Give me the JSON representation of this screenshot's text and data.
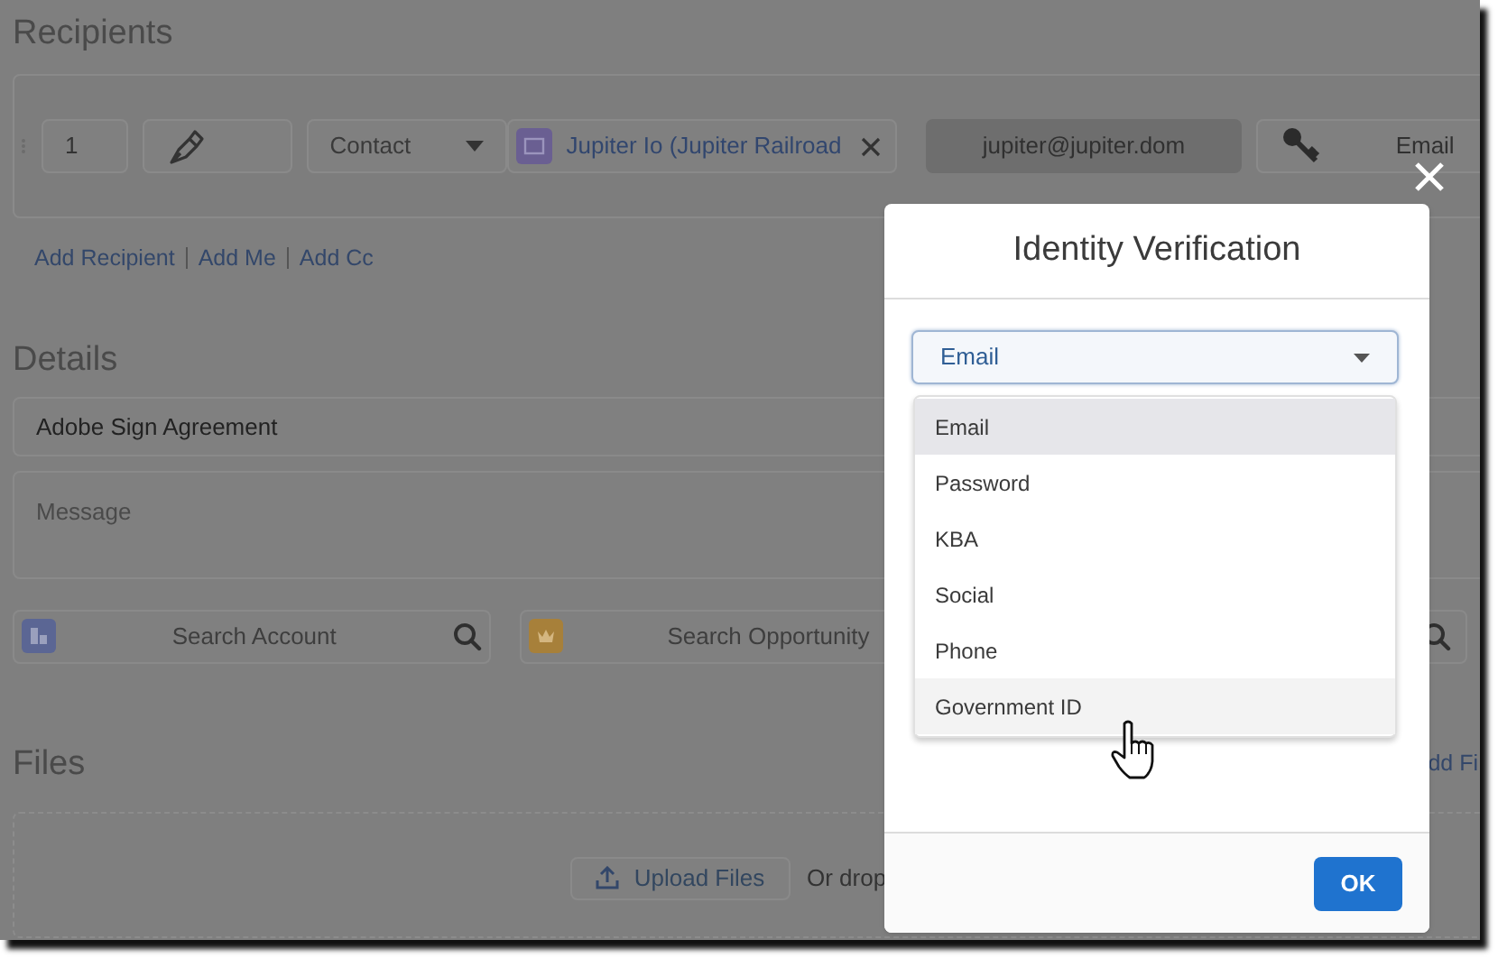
{
  "recipients": {
    "title": "Recipients",
    "row": {
      "order": "1",
      "type": "Contact",
      "contact": "Jupiter Io (Jupiter Railroad",
      "email": "jupiter@jupiter.dom",
      "verification": "Email"
    },
    "links": [
      "Add Recipient",
      "Add Me",
      "Add Cc"
    ]
  },
  "details": {
    "title": "Details",
    "agreement_name": "Adobe Sign Agreement",
    "message_placeholder": "Message",
    "search_account_placeholder": "Search Account",
    "search_opportunity_placeholder": "Search Opportunity"
  },
  "files": {
    "title": "Files",
    "add_files_link": "dd Fi",
    "upload_button": "Upload Files",
    "drop_text": "Or drop"
  },
  "dialog": {
    "title": "Identity Verification",
    "select_value": "Email",
    "ok_button": "OK",
    "options": [
      {
        "label": "Email",
        "selected": true,
        "hovered": false
      },
      {
        "label": "Password",
        "selected": false,
        "hovered": false
      },
      {
        "label": "KBA",
        "selected": false,
        "hovered": false
      },
      {
        "label": "Social",
        "selected": false,
        "hovered": false
      },
      {
        "label": "Phone",
        "selected": false,
        "hovered": false
      },
      {
        "label": "Government ID",
        "selected": false,
        "hovered": true
      }
    ]
  }
}
